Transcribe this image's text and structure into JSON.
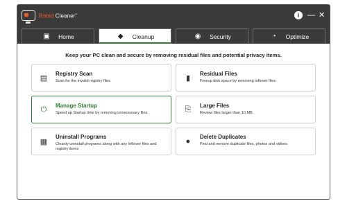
{
  "app": {
    "name_part1": "Rabid",
    "name_part2": " Cleaner",
    "trademark": "®",
    "brand_color": "#f05a28",
    "accent_color": "#2e7d32"
  },
  "window_controls": {
    "info_icon": "i",
    "minimize_icon": "—",
    "close_icon": "✕"
  },
  "tabs": [
    {
      "label": "Home",
      "icon": "home-folder-icon",
      "glyph": "▣",
      "active": false
    },
    {
      "label": "Cleanup",
      "icon": "paint-bucket-icon",
      "glyph": "◆",
      "active": true
    },
    {
      "label": "Security",
      "icon": "shield-person-icon",
      "glyph": "◉",
      "active": false
    },
    {
      "label": "Optimize",
      "icon": "speedometer-icon",
      "glyph": "◔",
      "active": false
    }
  ],
  "subtitle": "Keep your PC clean and secure by removing residual files and potential privacy items.",
  "cards": [
    {
      "title": "Registry Scan",
      "desc": "Scan for the invalid registry files",
      "icon": "registry-icon",
      "glyph": "▤"
    },
    {
      "title": "Residual Files",
      "desc": "Freeup disk space by removing leftover files",
      "icon": "residual-file-icon",
      "glyph": "▮"
    },
    {
      "title": "Manage Startup",
      "desc": "Speed up Startup time by removing unnecessary files",
      "icon": "power-icon",
      "glyph": "⏻",
      "selected": true
    },
    {
      "title": "Large Files",
      "desc": "Review files larger than 10 MB",
      "icon": "large-file-icon",
      "glyph": "⎘"
    },
    {
      "title": "Uninstall Programs",
      "desc": "Cleanly uninstall programs along with any leftover files and registry items",
      "icon": "uninstall-icon",
      "glyph": "▦"
    },
    {
      "title": "Delete Duplicates",
      "desc": "Find and remove duplicate files, photos and vidoes",
      "icon": "duplicate-icon",
      "glyph": "●"
    }
  ]
}
